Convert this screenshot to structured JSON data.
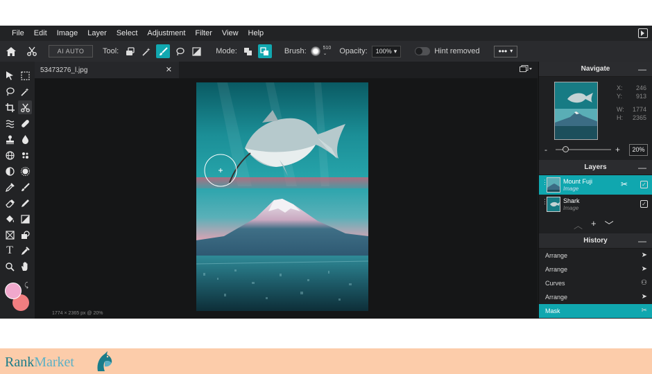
{
  "menu": [
    "File",
    "Edit",
    "Image",
    "Layer",
    "Select",
    "Adjustment",
    "Filter",
    "View",
    "Help"
  ],
  "toolbar": {
    "ai_auto": "AI AUTO",
    "tool_label": "Tool:",
    "mode_label": "Mode:",
    "brush_label": "Brush:",
    "brush_size": "510",
    "opacity_label": "Opacity:",
    "opacity_value": "100%",
    "hint_label": "Hint removed",
    "more": "•••"
  },
  "document": {
    "tab_title": "53473276_l.jpg",
    "status": "1774 × 2365 px @ 20%"
  },
  "navigate": {
    "title": "Navigate",
    "x_label": "X:",
    "x_value": "246",
    "y_label": "Y:",
    "y_value": "913",
    "w_label": "W:",
    "w_value": "1774",
    "h_label": "H:",
    "h_value": "2365",
    "zoom": "20%"
  },
  "layers": {
    "title": "Layers",
    "items": [
      {
        "name": "Mount Fuji",
        "type": "Image"
      },
      {
        "name": "Shark",
        "type": "Image"
      }
    ]
  },
  "history": {
    "title": "History",
    "items": [
      "Arrange",
      "Arrange",
      "Curves",
      "Arrange",
      "Mask"
    ]
  },
  "brand": {
    "rank": "Rank",
    "market": "Market"
  },
  "colors": {
    "accent": "#10a7af",
    "foreground": "#f0a8cc",
    "background": "#f17e80"
  }
}
